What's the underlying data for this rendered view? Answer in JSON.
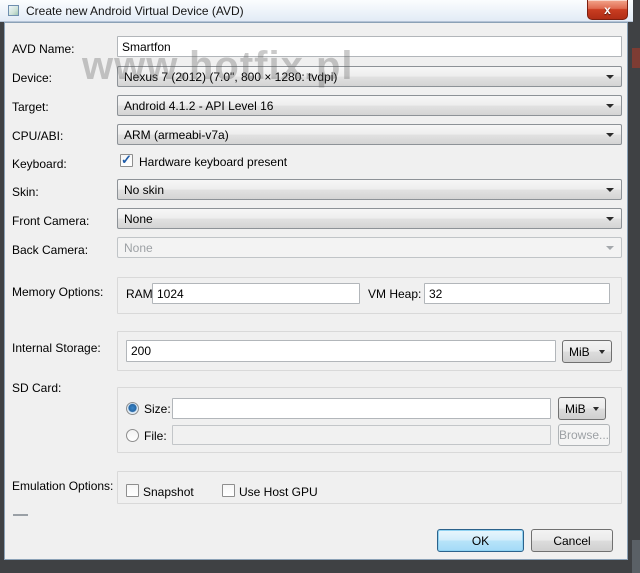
{
  "window": {
    "title": "Create new Android Virtual Device (AVD)",
    "close_glyph": "x"
  },
  "watermark": {
    "text": "www.hotfix.pl"
  },
  "fields": {
    "avd_name": {
      "label": "AVD Name:",
      "value": "Smartfon"
    },
    "device": {
      "label": "Device:",
      "value": "Nexus 7 (2012) (7.0\", 800 × 1280: tvdpi)"
    },
    "target": {
      "label": "Target:",
      "value": "Android 4.1.2 - API Level 16"
    },
    "cpu_abi": {
      "label": "CPU/ABI:",
      "value": "ARM (armeabi-v7a)"
    },
    "keyboard": {
      "label": "Keyboard:",
      "checkbox_label": "Hardware keyboard present",
      "checked": true
    },
    "skin": {
      "label": "Skin:",
      "value": "No skin"
    },
    "front_camera": {
      "label": "Front Camera:",
      "value": "None"
    },
    "back_camera": {
      "label": "Back Camera:",
      "value": "None",
      "disabled": true
    },
    "memory_options": {
      "label": "Memory Options:",
      "ram_label": "RAM:",
      "ram_value": "1024",
      "vm_heap_label": "VM Heap:",
      "vm_heap_value": "32"
    },
    "internal_storage": {
      "label": "Internal Storage:",
      "value": "200",
      "unit": "MiB"
    },
    "sd_card": {
      "label": "SD Card:",
      "size_label": "Size:",
      "size_value": "",
      "size_unit": "MiB",
      "size_selected": true,
      "file_label": "File:",
      "file_value": "",
      "file_disabled": true,
      "browse_label": "Browse..."
    },
    "emulation_options": {
      "label": "Emulation Options:",
      "snapshot_label": "Snapshot",
      "snapshot_checked": false,
      "use_host_gpu_label": "Use Host GPU",
      "use_host_gpu_checked": false
    }
  },
  "buttons": {
    "ok": "OK",
    "cancel": "Cancel"
  }
}
